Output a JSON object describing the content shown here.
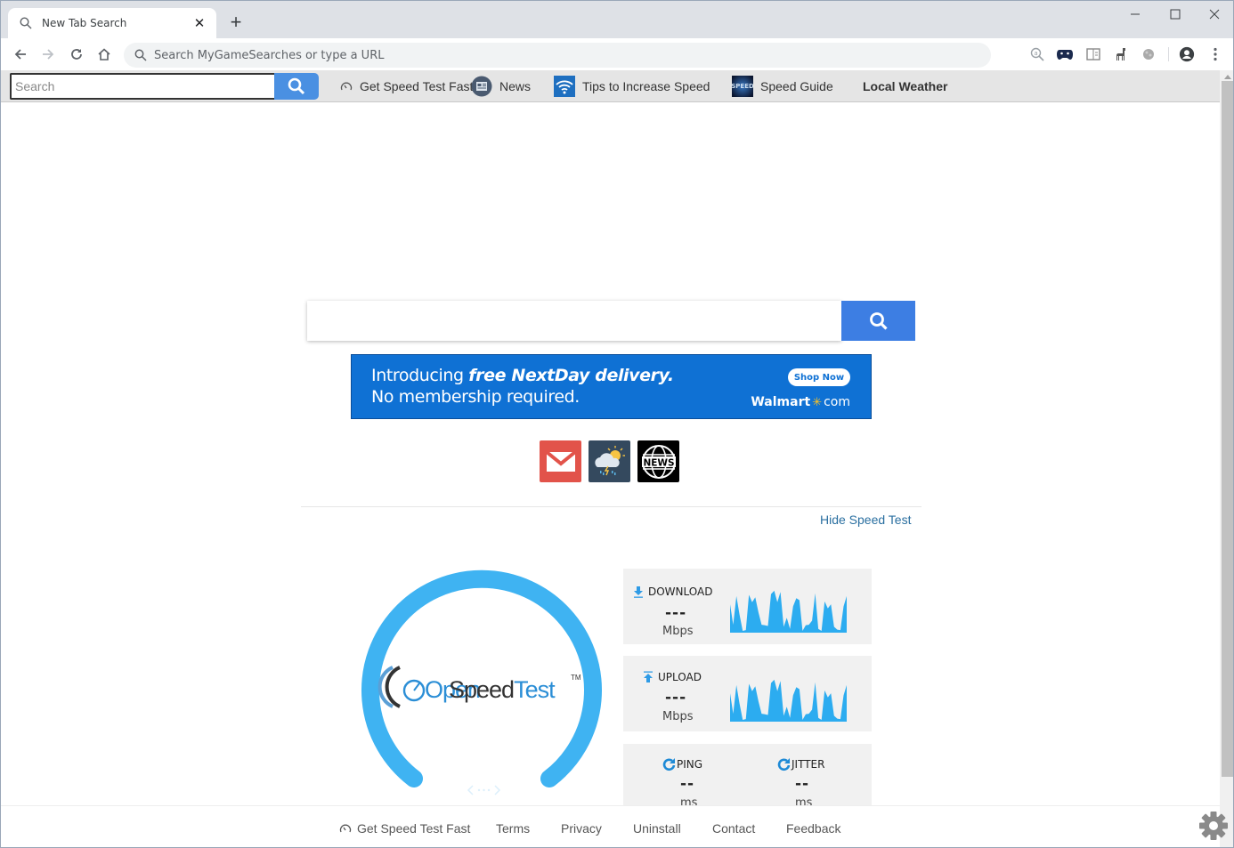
{
  "browser": {
    "tab": {
      "title": "New Tab Search",
      "icon": "search-icon"
    },
    "new_tab_label": "+",
    "window_controls": [
      "minimize",
      "maximize",
      "close"
    ],
    "omnibox": {
      "placeholder": "Search MyGameSearches or type a URL",
      "value": ""
    },
    "extensions": [
      "lens-search-icon",
      "gamepad-icon",
      "reader-icon",
      "llama-icon",
      "extension-icon",
      "profile-icon",
      "menu-icon"
    ]
  },
  "extbar": {
    "search_placeholder": "Search",
    "links": [
      {
        "label": "Get Speed Test Fast",
        "icon": "speedometer-icon"
      },
      {
        "label": "News",
        "icon": "news-icon"
      },
      {
        "label": "Tips to Increase Speed",
        "icon": "wifi-icon"
      },
      {
        "label": "Speed Guide",
        "icon": "speed-guide-icon"
      },
      {
        "label": "Local Weather",
        "icon": ""
      }
    ]
  },
  "main": {
    "search": {
      "value": "",
      "button_icon": "search-icon"
    },
    "ad": {
      "line1_plain": "Introducing ",
      "line1_bold": "free NextDay delivery.",
      "line2": "No membership required.",
      "cta": "Shop Now",
      "brand_name": "Walmart",
      "brand_suffix": "com"
    },
    "tiles": [
      {
        "name": "gmail",
        "icon": "mail-icon",
        "color": "#e2534a"
      },
      {
        "name": "weather",
        "icon": "weather-icon",
        "color": "#34495e"
      },
      {
        "name": "news",
        "icon": "news-globe-icon",
        "color": "#000000"
      }
    ],
    "hide_link": "Hide Speed Test"
  },
  "speedtest": {
    "logo": {
      "open": "Open",
      "speed": "Speed",
      "test": "Test",
      "tm": "TM"
    },
    "accent": "#2bb0f2",
    "download": {
      "label": "DOWNLOAD",
      "value": "---",
      "unit": "Mbps"
    },
    "upload": {
      "label": "UPLOAD",
      "value": "---",
      "unit": "Mbps"
    },
    "ping": {
      "label": "PING",
      "value": "--",
      "unit": "ms"
    },
    "jitter": {
      "label": "JITTER",
      "value": "--",
      "unit": "ms"
    },
    "sparkline": [
      0.65,
      0.15,
      0.85,
      0.4,
      0.0,
      0.02,
      0.88,
      0.7,
      0.82,
      0.45,
      0.15,
      0.14,
      0.12,
      0.9,
      0.98,
      0.7,
      0.95,
      0.1,
      0.32,
      0.05,
      0.6,
      0.8,
      0.75,
      0.0,
      0.14,
      0.15,
      0.25,
      0.92,
      0.05,
      0.0,
      0.72,
      0.55,
      0.65,
      0.1,
      0.03,
      0.02,
      0.6,
      0.85
    ]
  },
  "footer": {
    "links": [
      "Get Speed Test Fast",
      "Terms",
      "Privacy",
      "Uninstall",
      "Contact",
      "Feedback"
    ],
    "settings_icon": "gear-icon"
  }
}
